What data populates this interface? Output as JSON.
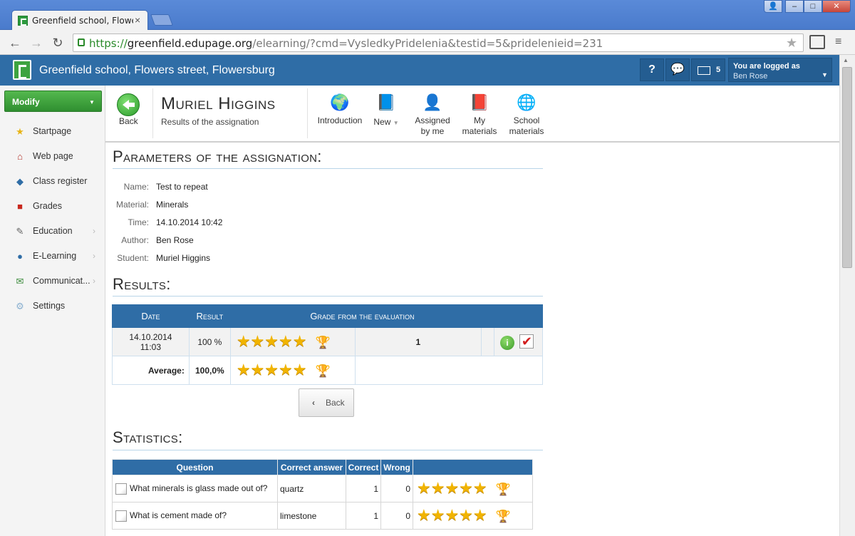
{
  "browser": {
    "tab_title": "Greenfield school, Flowers street, Flowersburg",
    "url_scheme": "https://",
    "url_host": "greenfield.edupage.org",
    "url_path": "/elearning/?cmd=VysledkyPridelenia&testid=5&pridelenieid=231"
  },
  "header": {
    "school": "Greenfield school, Flowers street, Flowersburg",
    "help": "?",
    "mail_count": "5",
    "logged_as_label": "You are logged as",
    "user_name": "Ben Rose"
  },
  "sidebar": {
    "modify": "Modify",
    "items": [
      {
        "label": "Startpage",
        "icon": "★",
        "color": "#e8b416"
      },
      {
        "label": "Web page",
        "icon": "⌂",
        "color": "#b3322a"
      },
      {
        "label": "Class register",
        "icon": "◆",
        "color": "#2f6da6"
      },
      {
        "label": "Grades",
        "icon": "■",
        "color": "#c8281e"
      },
      {
        "label": "Education",
        "icon": "✎",
        "color": "#666"
      },
      {
        "label": "E-Learning",
        "icon": "●",
        "color": "#2f6da6"
      },
      {
        "label": "Communicat...",
        "icon": "✉",
        "color": "#3a8a3a"
      },
      {
        "label": "Settings",
        "icon": "⚙",
        "color": "#8ab0d0"
      }
    ]
  },
  "ctoolbar": {
    "back": "Back",
    "student_name": "Muriel Higgins",
    "subtitle": "Results of the assignation",
    "buttons": [
      {
        "label": "Introduction",
        "label2": "",
        "icon": "🌍"
      },
      {
        "label": "New",
        "label2": "",
        "icon": "📘"
      },
      {
        "label": "Assigned",
        "label2": "by me",
        "icon": "👤"
      },
      {
        "label": "My",
        "label2": "materials",
        "icon": "📕"
      },
      {
        "label": "School",
        "label2": "materials",
        "icon": "🌐"
      }
    ]
  },
  "params": {
    "heading": "Parameters of the assignation:",
    "rows": [
      {
        "k": "Name:",
        "v": "Test to repeat"
      },
      {
        "k": "Material:",
        "v": "Minerals"
      },
      {
        "k": "Time:",
        "v": "14.10.2014 10:42"
      },
      {
        "k": "Author:",
        "v": "Ben Rose"
      },
      {
        "k": "Student:",
        "v": "Muriel Higgins"
      }
    ]
  },
  "results": {
    "heading": "Results:",
    "col_date": "Date",
    "col_result": "Result",
    "col_grade": "Grade from the evaluation",
    "row_date": "14.10.2014",
    "row_time": "11:03",
    "row_result": "100 %",
    "row_rating_stars": 5,
    "row_grade": "1",
    "avg_label": "Average:",
    "avg_value": "100,0%",
    "avg_rating_stars": 5,
    "back": "Back"
  },
  "statistics": {
    "heading": "Statistics:",
    "cols": [
      "Question",
      "Correct answer",
      "Correct",
      "Wrong"
    ],
    "rows": [
      {
        "q": "What minerals is glass made out of?",
        "a": "quartz",
        "c": "1",
        "w": "0",
        "stars": 5
      },
      {
        "q": "What is cement made of?",
        "a": "limestone",
        "c": "1",
        "w": "0",
        "stars": 5
      }
    ]
  }
}
